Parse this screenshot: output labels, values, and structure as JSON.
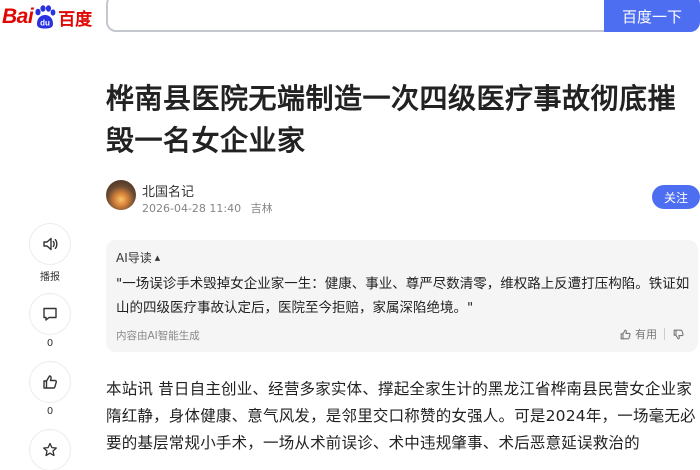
{
  "header": {
    "logo_latin": "Bai",
    "logo_paw_text": "du",
    "logo_cn": "百度",
    "search_button": "百度一下",
    "search_value": ""
  },
  "article": {
    "title": "桦南县医院无端制造一次四级医疗事故彻底摧毁一名女企业家",
    "author": "北国名记",
    "date": "2026-04-28 11:40",
    "location": "吉林",
    "follow_label": "关注"
  },
  "sidebar": {
    "items": [
      {
        "icon": "speaker-icon",
        "label": "播报"
      },
      {
        "icon": "comment-icon",
        "label": "0"
      },
      {
        "icon": "thumbs-up-icon",
        "label": "0"
      },
      {
        "icon": "star-icon",
        "label": ""
      }
    ]
  },
  "ai_summary": {
    "heading": "AI导读",
    "caret": "▲",
    "text": "\"一场误诊手术毁掉女企业家一生：健康、事业、尊严尽数清零，维权路上反遭打压构陷。铁证如山的四级医疗事故认定后，医院至今拒赔，家属深陷绝境。\"",
    "footer": "内容由AI智能生成",
    "useful_label": "有用"
  },
  "body": {
    "paragraph": "本站讯 昔日自主创业、经营多家实体、撑起全家生计的黑龙江省桦南县民营女企业家隋红静，身体健康、意气风发，是邻里交口称赞的女强人。可是2024年，一场毫无必要的基层常规小手术，一场从术前误诊、术中违规肇事、术后恶意延误救治的"
  },
  "colors": {
    "brand_red": "#e10601",
    "brand_blue": "#4e6ef2"
  }
}
